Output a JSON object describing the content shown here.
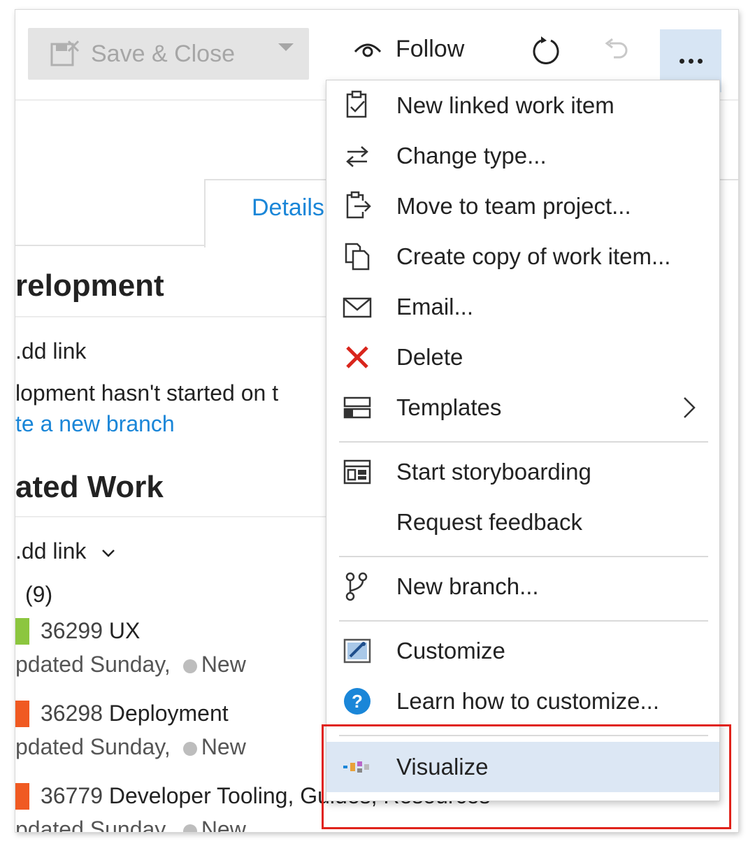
{
  "toolbar": {
    "save_label": "Save & Close",
    "follow_label": "Follow"
  },
  "tabs": {
    "details": "Details"
  },
  "form": {
    "development_heading": "relopment",
    "add_link_1": ".dd link",
    "development_text": "lopment hasn't started on t",
    "create_branch_link": "te a new branch",
    "related_heading": "ated Work",
    "add_link_2": ".dd link",
    "child_count": "(9)",
    "items": [
      {
        "id": "36299",
        "title": "UX",
        "meta": "pdated Sunday,",
        "state": "New",
        "color": "#8cc63f"
      },
      {
        "id": "36298",
        "title": "Deployment",
        "meta": "pdated Sunday,",
        "state": "New",
        "color": "#f05a22"
      },
      {
        "id": "36779",
        "title": "Developer Tooling, Guides, Resources",
        "meta": "pdated Sunday,",
        "state": "New",
        "color": "#f05a22"
      }
    ]
  },
  "menu": {
    "items": [
      {
        "label": "New linked work item",
        "icon": "clipboard-check-icon"
      },
      {
        "label": "Change type...",
        "icon": "swap-arrows-icon"
      },
      {
        "label": "Move to team project...",
        "icon": "move-clipboard-icon"
      },
      {
        "label": "Create copy of work item...",
        "icon": "copy-icon"
      },
      {
        "label": "Email...",
        "icon": "mail-icon"
      },
      {
        "label": "Delete",
        "icon": "delete-x-icon"
      },
      {
        "label": "Templates",
        "icon": "templates-icon"
      },
      {
        "label": "Start storyboarding",
        "icon": "storyboard-icon"
      },
      {
        "label": "Request feedback",
        "icon": ""
      },
      {
        "label": "New branch...",
        "icon": "branch-icon"
      },
      {
        "label": "Customize",
        "icon": "customize-icon"
      },
      {
        "label": "Learn how to customize...",
        "icon": "help-icon"
      },
      {
        "label": "Visualize",
        "icon": "visualize-icon"
      }
    ]
  },
  "colors": {
    "accent": "#1a86d8",
    "delete": "#d9251c",
    "highlight_border": "#e0231b",
    "menu_highlight": "#dce7f4"
  }
}
